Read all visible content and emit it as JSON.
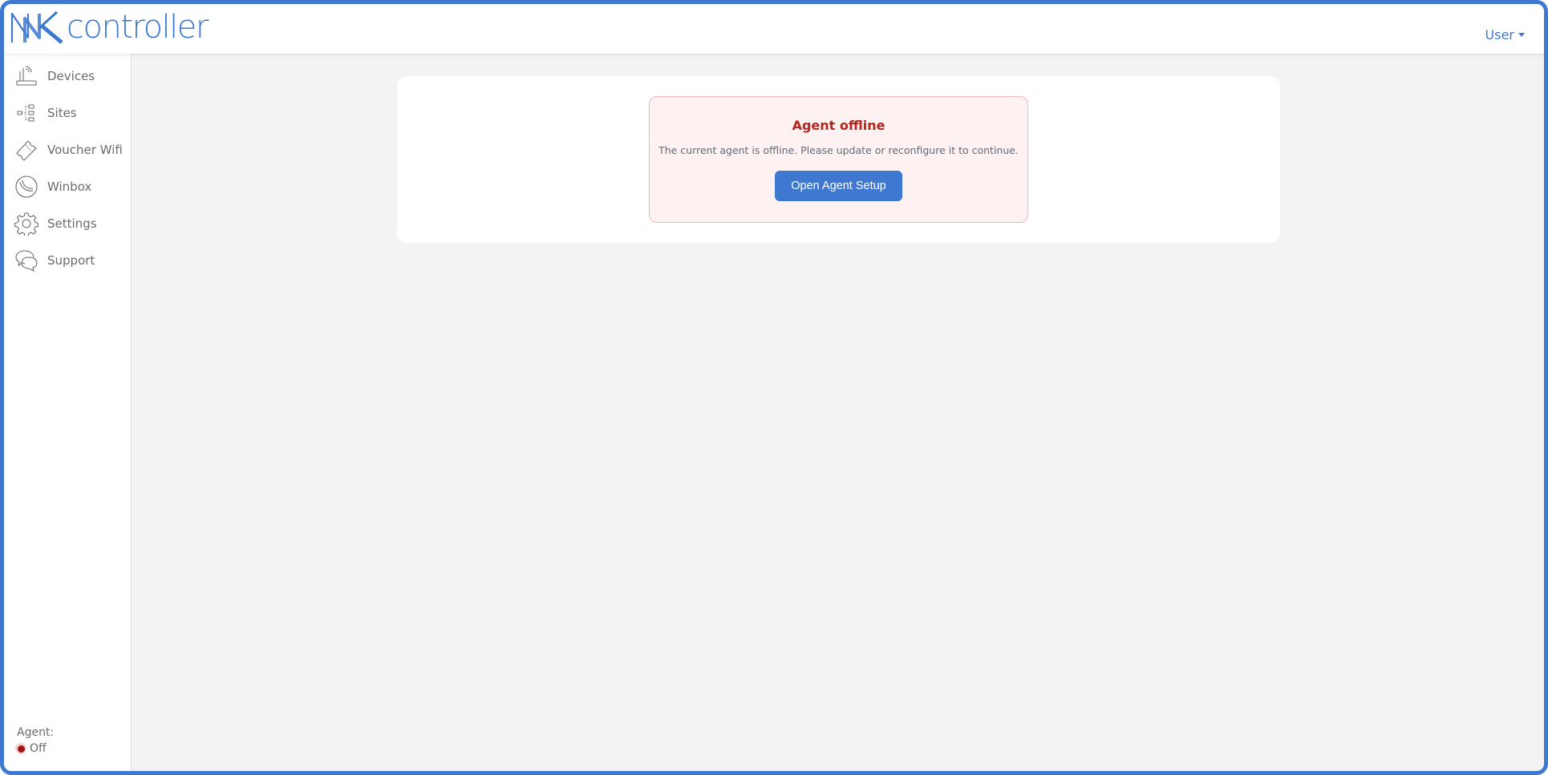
{
  "header": {
    "logo_text": "controller",
    "user_label": "User"
  },
  "sidebar": {
    "items": [
      {
        "label": "Devices",
        "icon": "router-icon"
      },
      {
        "label": "Sites",
        "icon": "sitemap-icon"
      },
      {
        "label": "Voucher Wifi",
        "icon": "ticket-icon"
      },
      {
        "label": "Winbox",
        "icon": "winbox-icon"
      },
      {
        "label": "Settings",
        "icon": "gear-icon"
      },
      {
        "label": "Support",
        "icon": "chat-bubbles-icon"
      }
    ],
    "agent": {
      "label": "Agent:",
      "status": "Off",
      "status_color": "#a31515"
    }
  },
  "alert": {
    "title": "Agent offline",
    "message": "The current agent is offline. Please update or reconfigure it to continue.",
    "button_label": "Open Agent Setup"
  },
  "colors": {
    "accent": "#3f78d1",
    "error": "#b3261e",
    "alert_bg": "#fdf2f1",
    "page_bg": "#f3f3f3"
  }
}
